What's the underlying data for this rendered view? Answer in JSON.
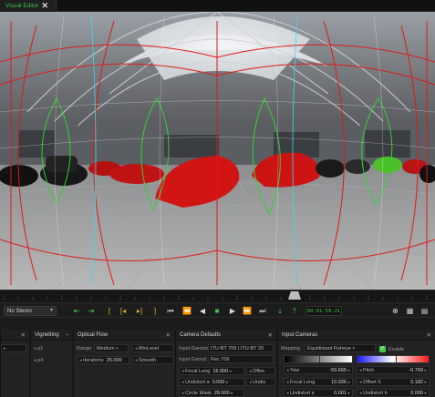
{
  "tab": {
    "label": "Visual Editor",
    "close": "✕"
  },
  "transport": {
    "stereo_mode": "No Stereo",
    "timecode": "00:01:59:21",
    "buttons": [
      "mark-in",
      "mark-out",
      "set-in",
      "go-in",
      "go-out",
      "set-out",
      "go-start",
      "prev-frame",
      "play-reverse",
      "stop",
      "play",
      "next-frame",
      "go-end",
      "add-key",
      "delete-key"
    ]
  },
  "panels": {
    "left_stub": {
      "close": "✕"
    },
    "vignetting": {
      "title": "Vignetting",
      "items": [
        "p1",
        "p4"
      ]
    },
    "optical_flow": {
      "title": "Optical Flow",
      "range_label": "Range",
      "range_value": "Medium",
      "minlevel_label": "MinLevel",
      "iterations_label": "Iterations",
      "iterations_value": "25.000",
      "smooth_label": "Smooth"
    },
    "camera_defaults": {
      "title": "Camera Defaults",
      "input_gamma_label": "Input Gamma",
      "input_gamma_value": "ITU-BT 709 | ITU-BT 20",
      "input_gamut_label": "Input Gamut",
      "input_gamut_value": "Rec.709",
      "focal_length_label": "Focal Leng",
      "focal_length_value": "16.000",
      "offset_label": "Offse",
      "undistort_a_label": "Undistort a",
      "undistort_a_value": "0.000",
      "undist_label": "Undis",
      "circle_mask_label": "Circle Mask",
      "circle_mask_value": "29.000"
    },
    "input_cameras": {
      "title": "Input Cameras",
      "mapping_label": "Mapping",
      "mapping_value": "Equidistant Fisheye",
      "enable_label": "Enable",
      "yaw_label": "Yaw",
      "yaw_value": "-59.665",
      "pitch_label": "Pitch",
      "pitch_value": "-0.769",
      "focal_length_label": "Focal Leng",
      "focal_length_value": "10.926",
      "offset_x_label": "Offset X",
      "offset_x_value": "0.182",
      "undistort_a_label": "Undistort a",
      "undistort_a_value": "0.001",
      "undistort_b_label": "Undistort b",
      "undistort_b_value": "0.000"
    }
  },
  "colors": {
    "accent_green": "#3fc94a",
    "overlay_red": "#e01818",
    "overlay_green": "#35d035",
    "overlay_cyan": "#3fd8e8",
    "yellow": "#e2b227"
  }
}
